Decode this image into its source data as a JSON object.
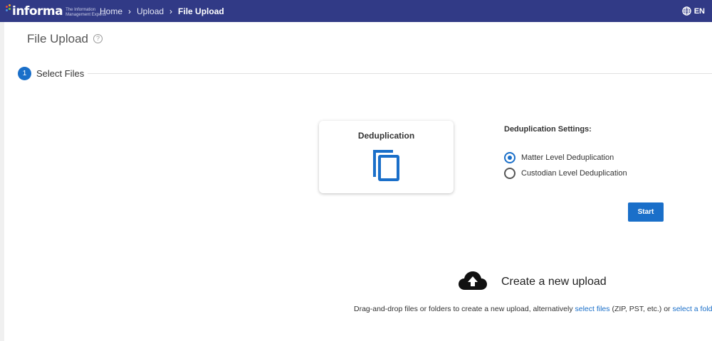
{
  "header": {
    "logo_text": "informa",
    "logo_tagline": "The Information Management Experts",
    "breadcrumb": [
      {
        "label": "Home"
      },
      {
        "label": "Upload"
      },
      {
        "label": "File Upload"
      }
    ],
    "language": "EN",
    "bar_color": "#313a86"
  },
  "page": {
    "title": "File Upload",
    "help_icon": "?"
  },
  "stepper": {
    "number": "1",
    "label": "Select Files"
  },
  "dedup_card": {
    "title": "Deduplication",
    "icon": "copy-icon"
  },
  "settings": {
    "title": "Deduplication Settings:",
    "options": [
      {
        "label": "Matter Level Deduplication",
        "selected": true
      },
      {
        "label": "Custodian Level Deduplication",
        "selected": false
      }
    ],
    "start_label": "Start"
  },
  "upload": {
    "title": "Create a new upload",
    "text_before": "Drag-and-drop files or folders to create a new upload, alternatively ",
    "link_files": "select files",
    "text_middle": " (ZIP, PST, etc.) or ",
    "link_folder": "select a folder"
  },
  "accent_color": "#1a6fc9"
}
